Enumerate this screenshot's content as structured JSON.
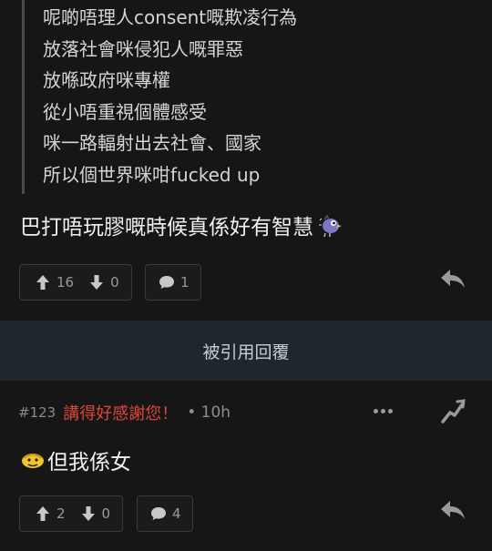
{
  "post1": {
    "quote_lines": [
      "呢啲唔理人consent嘅欺凌行為",
      "放落社會咪侵犯人嘅罪惡",
      "放喺政府咪專權",
      "從小唔重視個體感受",
      "咪一路輻射出去社會、國家",
      "所以個世界咪咁fucked up"
    ],
    "text": "巴打唔玩膠嘅時候真係好有智慧",
    "sticker_icon": "purple-bird-sticker",
    "upvotes": "16",
    "downvotes": "0",
    "comments": "1"
  },
  "quoted_label": "被引用回覆",
  "post2": {
    "floor": "#123",
    "author": "講得好感謝您！",
    "time": "• 10h",
    "text": "但我係女",
    "emoji_icon": "yellow-emoji-sticker",
    "upvotes": "2",
    "downvotes": "0",
    "comments": "4"
  },
  "colors": {
    "author": "#e0453b",
    "quoted_bar": "#1f272c",
    "background": "#161616"
  }
}
